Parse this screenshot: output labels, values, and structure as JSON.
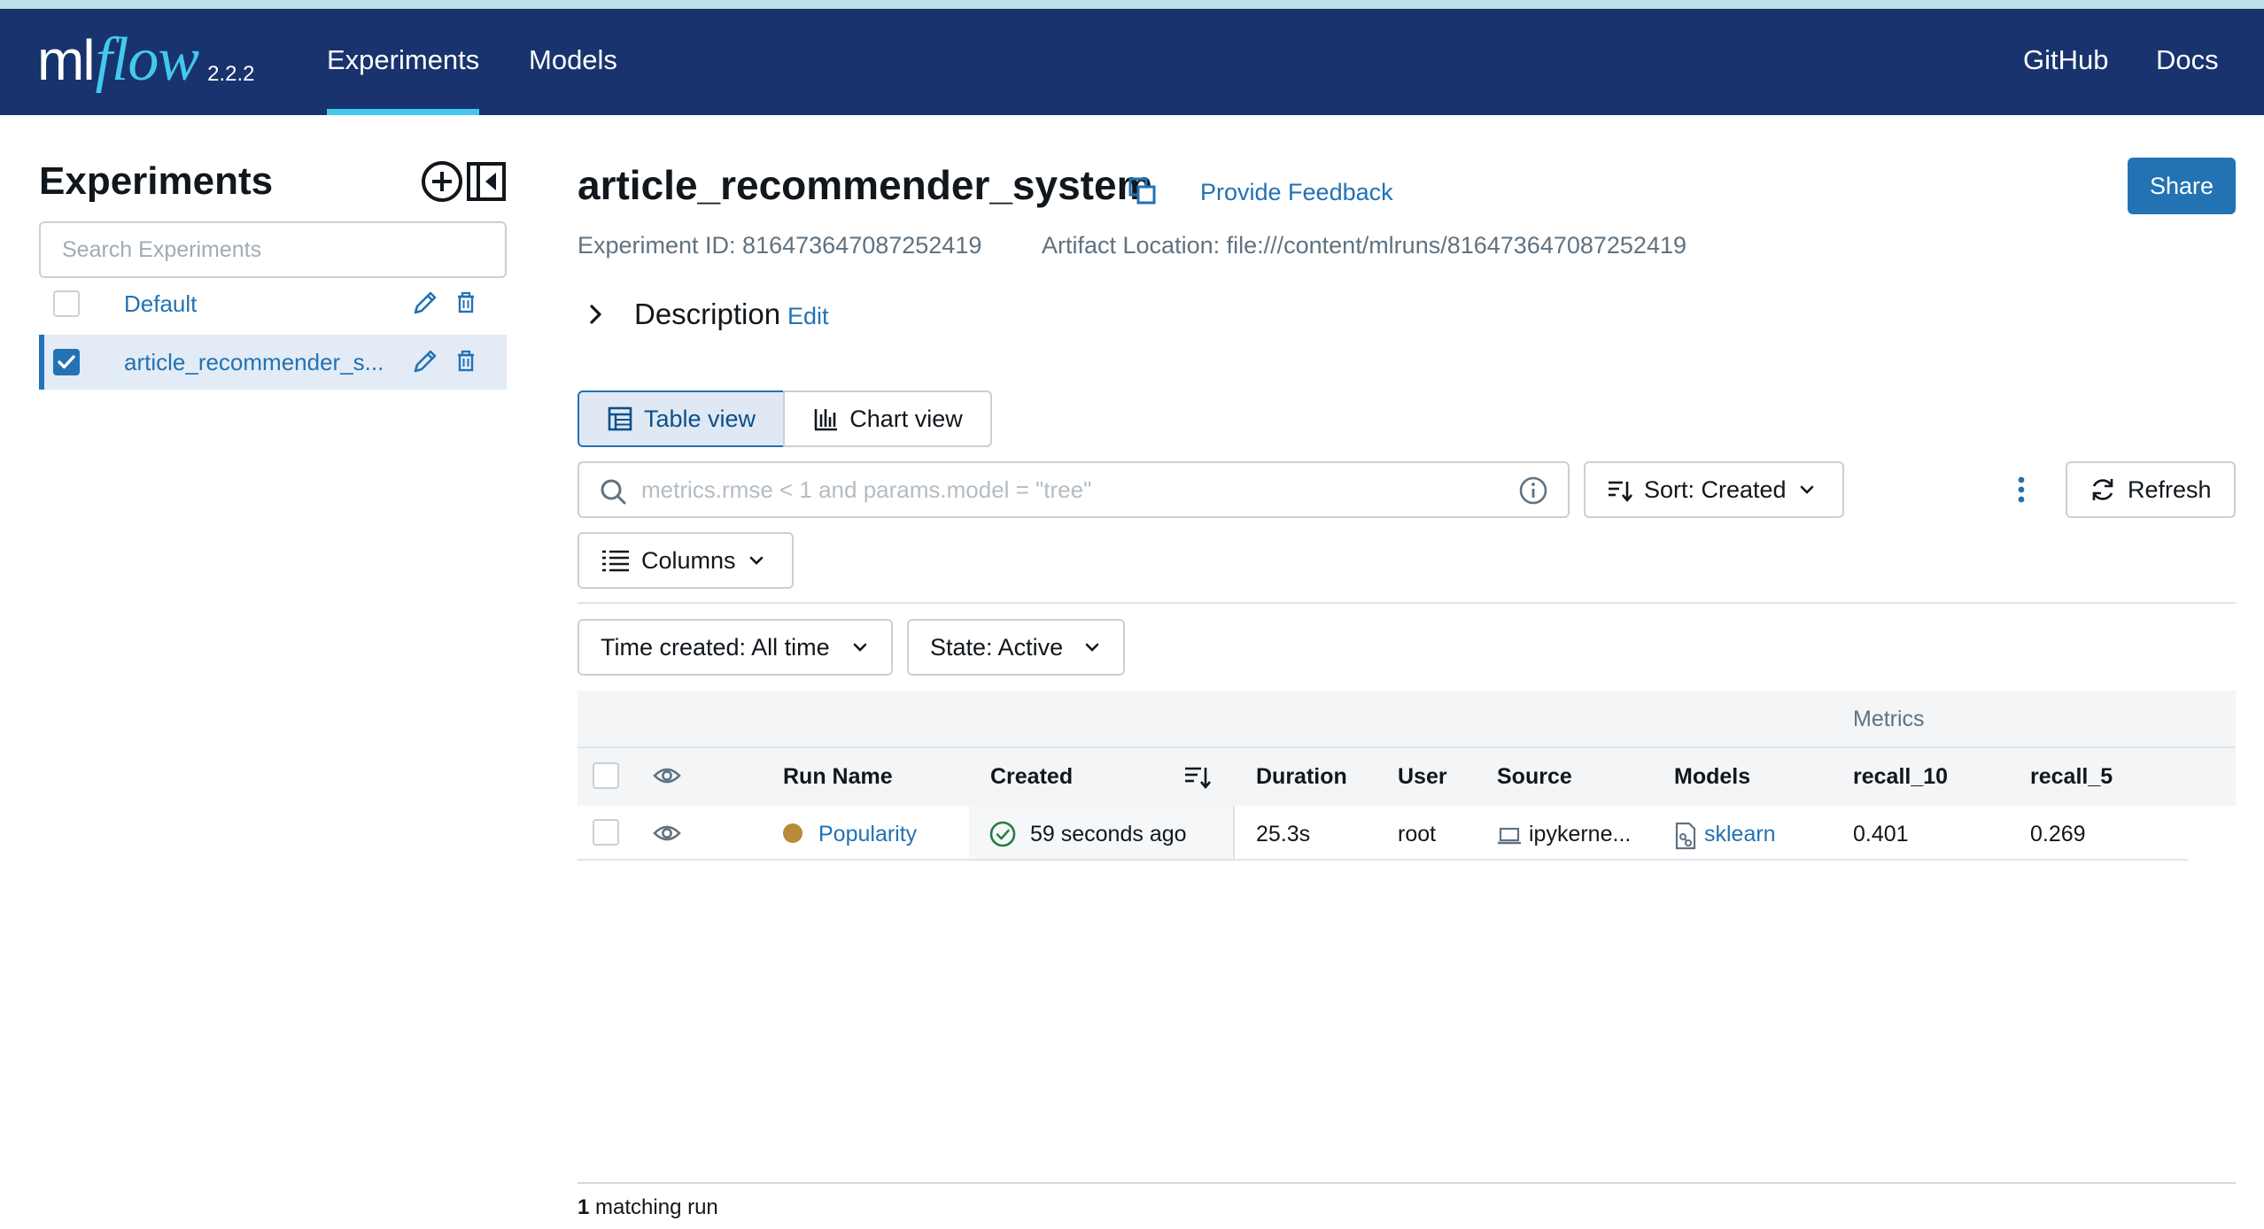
{
  "nav": {
    "logo_ml": "ml",
    "logo_flow": "flow",
    "version": "2.2.2",
    "links": {
      "experiments": "Experiments",
      "models": "Models",
      "github": "GitHub",
      "docs": "Docs"
    },
    "active": "Experiments"
  },
  "sidebar": {
    "title": "Experiments",
    "search_placeholder": "Search Experiments",
    "experiments": [
      {
        "name": "Default",
        "checked": false,
        "selected": false
      },
      {
        "name": "article_recommender_s...",
        "checked": true,
        "selected": true
      }
    ]
  },
  "experiment": {
    "title": "article_recommender_system",
    "feedback_label": "Provide Feedback",
    "share_label": "Share",
    "id_text": "Experiment ID: 816473647087252419",
    "artifact_text": "Artifact Location: file:///content/mlruns/816473647087252419",
    "description_label": "Description",
    "description_edit": "Edit"
  },
  "views": {
    "table": "Table view",
    "chart": "Chart view",
    "active": "table"
  },
  "filters": {
    "search_placeholder": "metrics.rmse < 1 and params.model = \"tree\"",
    "sort_label": "Sort: Created",
    "refresh_label": "Refresh",
    "columns_label": "Columns",
    "time_label": "Time created: All time",
    "state_label": "State: Active"
  },
  "table": {
    "group_header": "Metrics",
    "columns": {
      "run_name": "Run Name",
      "created": "Created",
      "duration": "Duration",
      "user": "User",
      "source": "Source",
      "models": "Models",
      "recall_10": "recall_10",
      "recall_5": "recall_5"
    },
    "rows": [
      {
        "run_name": "Popularity",
        "created": "59 seconds ago",
        "status": "finished",
        "duration": "25.3s",
        "user": "root",
        "source": "ipykerne...",
        "model": "sklearn",
        "recall_10": "0.401",
        "recall_5": "0.269"
      }
    ]
  },
  "footer": {
    "count": "1",
    "text": "matching run"
  },
  "colors": {
    "nav_bg": "#18336d",
    "accent": "#43c9ed",
    "primary": "#2272b4",
    "run_dot": "#b88a3a",
    "success": "#277c43"
  }
}
